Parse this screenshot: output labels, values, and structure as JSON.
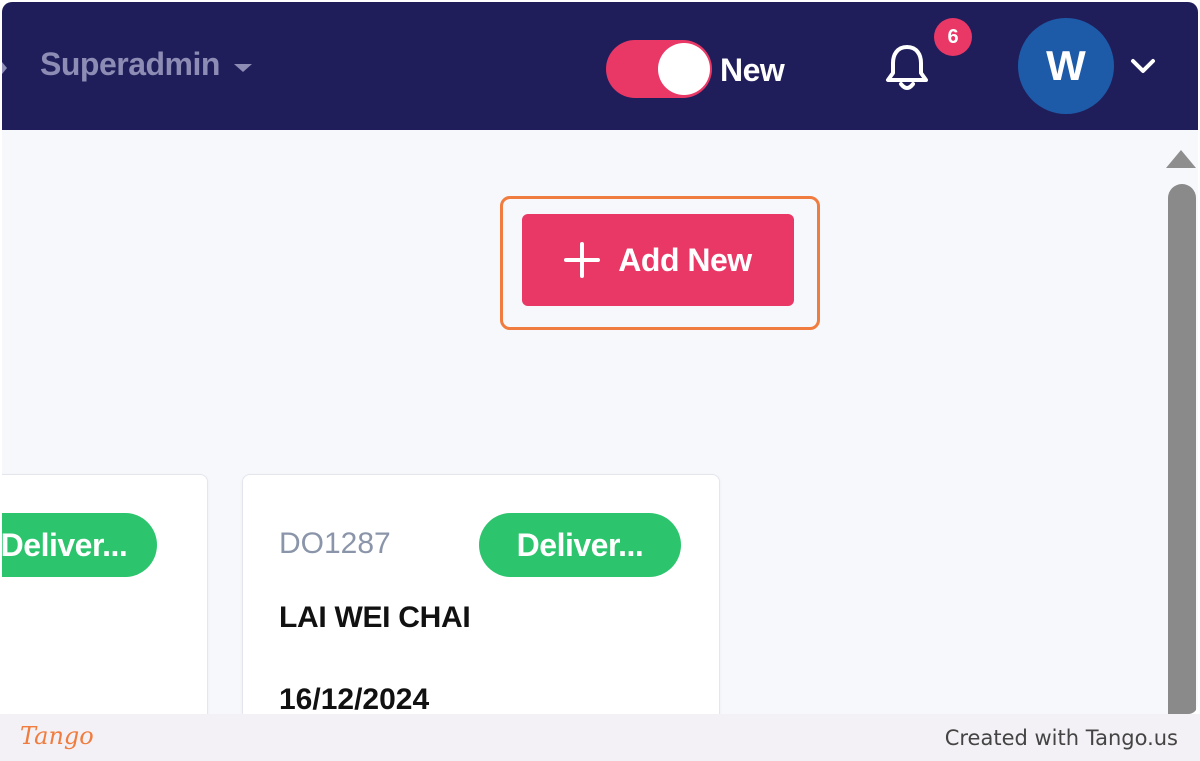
{
  "header": {
    "role_label": "Superadmin",
    "toggle_label": "New",
    "notification_count": "6",
    "avatar_initial": "W"
  },
  "actions": {
    "add_new_label": "Add New"
  },
  "cards": [
    {
      "status": "Deliver..."
    },
    {
      "do_number": "DO1287",
      "status": "Deliver...",
      "customer": "LAI WEI CHAI",
      "date": "16/12/2024"
    }
  ],
  "footer": {
    "logo_text": "Tango",
    "credit_text": "Created with Tango.us"
  },
  "colors": {
    "topbar": "#201e5a",
    "accent": "#e93766",
    "status_delivered": "#2cc56d",
    "avatar": "#1d5ba9",
    "highlight": "#f07d3f"
  }
}
